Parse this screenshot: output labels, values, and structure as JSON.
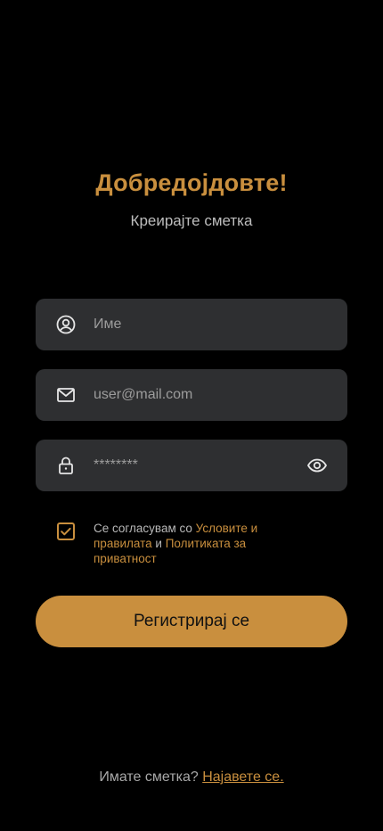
{
  "header": {
    "title": "Добредојдовте!",
    "subtitle": "Креирајте сметка"
  },
  "form": {
    "name": {
      "placeholder": "Име",
      "icon": "user-circle-icon"
    },
    "email": {
      "placeholder": "user@mail.com",
      "icon": "mail-icon"
    },
    "password": {
      "placeholder": "********",
      "icon": "lock-icon",
      "toggle_icon": "eye-icon"
    }
  },
  "terms": {
    "checked": true,
    "prefix": "Се согласувам со ",
    "terms_link": "Условите и правилата",
    "conjunction": " и ",
    "privacy_link": "Политиката за приватност"
  },
  "submit_label": "Регистрирај се",
  "footer": {
    "question": "Имате сметка?",
    "login_link": "Најавете се."
  },
  "colors": {
    "background": "#000000",
    "accent": "#c98f3e",
    "field_bg": "#2e2f31",
    "muted_text": "#bdbdbd"
  }
}
